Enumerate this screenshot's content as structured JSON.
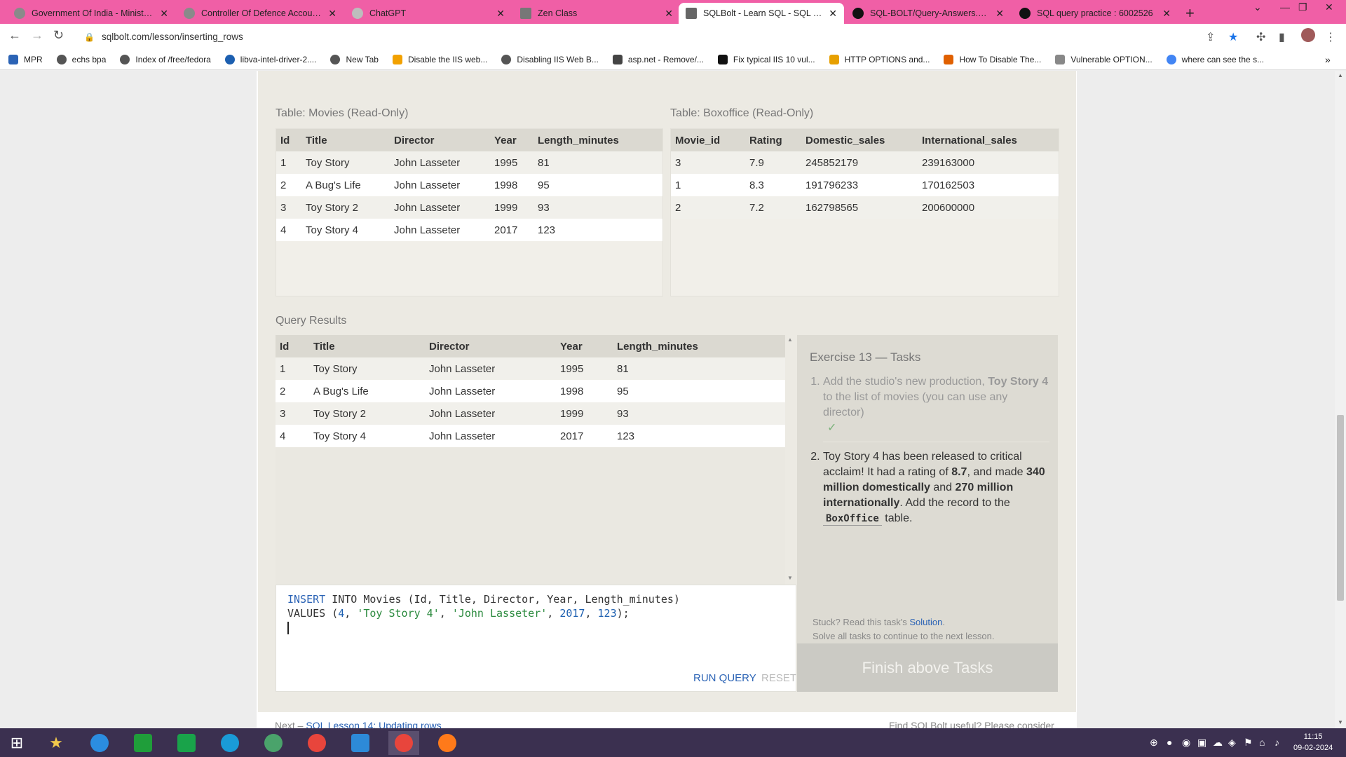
{
  "browser": {
    "tabs": [
      {
        "title": "Government Of India - Ministry o",
        "color": "#888888"
      },
      {
        "title": "Controller Of Defence Accounts",
        "color": "#888888"
      },
      {
        "title": "ChatGPT",
        "color": "#a6a6a6"
      },
      {
        "title": "Zen Class",
        "color": "#666666"
      },
      {
        "title": "SQLBolt - Learn SQL - SQL Lesso",
        "color": "#555555"
      },
      {
        "title": "SQL-BOLT/Query-Answers.sql at",
        "color": "#111111"
      },
      {
        "title": "SQL query practice : 6002526",
        "color": "#111111"
      }
    ],
    "url": "sqlbolt.com/lesson/inserting_rows",
    "bookmarks": [
      {
        "label": "MPR",
        "icon": "bookmark-icon",
        "color": "#2b63b5"
      },
      {
        "label": "echs bpa",
        "icon": "globe-icon",
        "color": "#555555"
      },
      {
        "label": "Index of /free/fedora",
        "icon": "globe-icon",
        "color": "#555555"
      },
      {
        "label": "libva-intel-driver-2....",
        "icon": "search-icon",
        "color": "#1c5fb0"
      },
      {
        "label": "New Tab",
        "icon": "globe-icon",
        "color": "#555555"
      },
      {
        "label": "Disable the IIS web...",
        "icon": "bookmark-icon",
        "color": "#f2a100"
      },
      {
        "label": "Disabling IIS Web B...",
        "icon": "globe-icon",
        "color": "#555555"
      },
      {
        "label": "asp.net - Remove/...",
        "icon": "bookmark-icon",
        "color": "#444444"
      },
      {
        "label": "Fix typical IIS 10 vul...",
        "icon": "bookmark-icon",
        "color": "#111111"
      },
      {
        "label": "HTTP OPTIONS and...",
        "icon": "windows-icon",
        "color": "#e7a000"
      },
      {
        "label": "How To Disable The...",
        "icon": "bookmark-icon",
        "color": "#e06000"
      },
      {
        "label": "Vulnerable OPTION...",
        "icon": "bookmark-icon",
        "color": "#888888"
      },
      {
        "label": "where can see the s...",
        "icon": "google-icon",
        "color": "#4285f4"
      }
    ]
  },
  "lesson": {
    "movies_table": {
      "label": "Table: Movies (Read-Only)",
      "columns": [
        "Id",
        "Title",
        "Director",
        "Year",
        "Length_minutes"
      ],
      "rows": [
        [
          "1",
          "Toy Story",
          "John Lasseter",
          "1995",
          "81"
        ],
        [
          "2",
          "A Bug's Life",
          "John Lasseter",
          "1998",
          "95"
        ],
        [
          "3",
          "Toy Story 2",
          "John Lasseter",
          "1999",
          "93"
        ],
        [
          "4",
          "Toy Story 4",
          "John Lasseter",
          "2017",
          "123"
        ]
      ]
    },
    "boxoffice_table": {
      "label": "Table: Boxoffice (Read-Only)",
      "columns": [
        "Movie_id",
        "Rating",
        "Domestic_sales",
        "International_sales"
      ],
      "rows": [
        [
          "3",
          "7.9",
          "245852179",
          "239163000"
        ],
        [
          "1",
          "8.3",
          "191796233",
          "170162503"
        ],
        [
          "2",
          "7.2",
          "162798565",
          "200600000"
        ]
      ]
    },
    "query_results": {
      "label": "Query Results",
      "columns": [
        "Id",
        "Title",
        "Director",
        "Year",
        "Length_minutes"
      ],
      "rows": [
        [
          "1",
          "Toy Story",
          "John Lasseter",
          "1995",
          "81"
        ],
        [
          "2",
          "A Bug's Life",
          "John Lasseter",
          "1998",
          "95"
        ],
        [
          "3",
          "Toy Story 2",
          "John Lasseter",
          "1999",
          "93"
        ],
        [
          "4",
          "Toy Story 4",
          "John Lasseter",
          "2017",
          "123"
        ]
      ]
    },
    "editor": {
      "line1_kw1": "INSERT",
      "line1_rest": " INTO Movies (Id, Title, Director, Year, Length_minutes)",
      "line2_a": "VALUES (",
      "line2_n1": "4",
      "line2_sep1": ", ",
      "line2_s1": "'Toy Story 4'",
      "line2_sep2": ", ",
      "line2_s2": "'John Lasseter'",
      "line2_sep3": ", ",
      "line2_n2": "2017",
      "line2_sep4": ", ",
      "line2_n3": "123",
      "line2_end": ");",
      "run_label": "RUN QUERY",
      "reset_label": "RESET"
    },
    "tasks": {
      "title": "Exercise 13 — Tasks",
      "task1_a": "Add the studio's new production, ",
      "task1_b": "Toy Story 4",
      "task1_c": " to the list of movies (you can use any director)",
      "task1_check": "✓",
      "task2_a": "Toy Story 4 has been released to critical acclaim! It had a rating of ",
      "task2_b": "8.7",
      "task2_c": ", and made ",
      "task2_d": "340 million domestically",
      "task2_e": " and ",
      "task2_f": "270 million internationally",
      "task2_g": ". Add the record to the ",
      "task2_h": "BoxOffice",
      "task2_i": " table.",
      "stuck_a": "Stuck? Read this task's ",
      "stuck_link": "Solution",
      "stuck_b": ".",
      "stuck_line2": "Solve all tasks to continue to the next lesson.",
      "finish_label": "Finish above Tasks"
    },
    "footer": {
      "next_prefix": "Next – ",
      "next_link": "SQL Lesson 14: Updating rows",
      "right_text": "Find SQLBolt useful? Please consider"
    }
  },
  "taskbar": {
    "time": "11:15",
    "date": "09-02-2024",
    "apps": [
      {
        "name": "start",
        "color": "#ffffff"
      },
      {
        "name": "favorites",
        "color": "#f2c94c"
      },
      {
        "name": "internet-explorer",
        "color": "#2b8de0"
      },
      {
        "name": "spreadsheet-green",
        "color": "#1f9e3a"
      },
      {
        "name": "calculator",
        "color": "#19a34a"
      },
      {
        "name": "edge",
        "color": "#1a9bd7"
      },
      {
        "name": "globe",
        "color": "#4aa36b"
      },
      {
        "name": "chrome",
        "color": "#e8453c"
      },
      {
        "name": "vscode",
        "color": "#2d8ad8"
      },
      {
        "name": "chrome-active",
        "color": "#e8453c"
      },
      {
        "name": "firefox",
        "color": "#ff7a1a"
      }
    ]
  }
}
